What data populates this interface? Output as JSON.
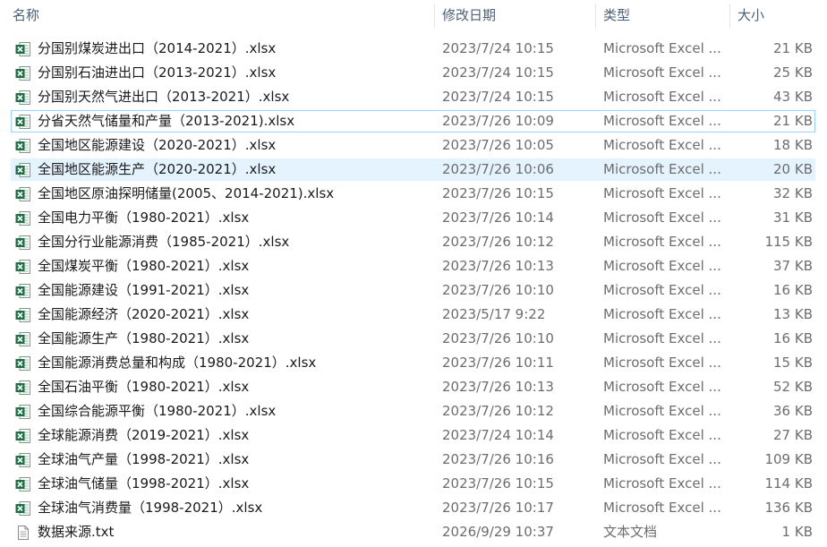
{
  "columns": {
    "name": "名称",
    "date": "修改日期",
    "type": "类型",
    "size": "大小"
  },
  "sort_arrow": "^",
  "files": [
    {
      "name": "分国别煤炭进出口（2014-2021）.xlsx",
      "date": "2023/7/24 10:15",
      "type": "Microsoft Excel ...",
      "size": "21 KB",
      "icon": "excel-file-icon"
    },
    {
      "name": "分国别石油进出口（2013-2021）.xlsx",
      "date": "2023/7/24 10:15",
      "type": "Microsoft Excel ...",
      "size": "25 KB",
      "icon": "excel-file-icon"
    },
    {
      "name": "分国别天然气进出口（2013-2021）.xlsx",
      "date": "2023/7/24 10:15",
      "type": "Microsoft Excel ...",
      "size": "43 KB",
      "icon": "excel-file-icon"
    },
    {
      "name": "分省天然气储量和产量（2013-2021).xlsx",
      "date": "2023/7/26 10:09",
      "type": "Microsoft Excel ...",
      "size": "21 KB",
      "icon": "excel-file-icon"
    },
    {
      "name": "全国地区能源建设（2020-2021）.xlsx",
      "date": "2023/7/26 10:05",
      "type": "Microsoft Excel ...",
      "size": "18 KB",
      "icon": "excel-file-icon"
    },
    {
      "name": "全国地区能源生产（2020-2021）.xlsx",
      "date": "2023/7/26 10:06",
      "type": "Microsoft Excel ...",
      "size": "20 KB",
      "icon": "excel-file-icon"
    },
    {
      "name": "全国地区原油探明储量(2005、2014-2021).xlsx",
      "date": "2023/7/26 10:15",
      "type": "Microsoft Excel ...",
      "size": "32 KB",
      "icon": "excel-file-icon"
    },
    {
      "name": "全国电力平衡（1980-2021）.xlsx",
      "date": "2023/7/26 10:14",
      "type": "Microsoft Excel ...",
      "size": "31 KB",
      "icon": "excel-file-icon"
    },
    {
      "name": "全国分行业能源消费（1985-2021）.xlsx",
      "date": "2023/7/26 10:12",
      "type": "Microsoft Excel ...",
      "size": "115 KB",
      "icon": "excel-file-icon"
    },
    {
      "name": "全国煤炭平衡（1980-2021）.xlsx",
      "date": "2023/7/26 10:13",
      "type": "Microsoft Excel ...",
      "size": "37 KB",
      "icon": "excel-file-icon"
    },
    {
      "name": "全国能源建设（1991-2021）.xlsx",
      "date": "2023/7/26 10:10",
      "type": "Microsoft Excel ...",
      "size": "16 KB",
      "icon": "excel-file-icon"
    },
    {
      "name": "全国能源经济（2020-2021）.xlsx",
      "date": "2023/5/17 9:22",
      "type": "Microsoft Excel ...",
      "size": "13 KB",
      "icon": "excel-file-icon"
    },
    {
      "name": "全国能源生产（1980-2021）.xlsx",
      "date": "2023/7/26 10:10",
      "type": "Microsoft Excel ...",
      "size": "16 KB",
      "icon": "excel-file-icon"
    },
    {
      "name": "全国能源消费总量和构成（1980-2021）.xlsx",
      "date": "2023/7/26 10:11",
      "type": "Microsoft Excel ...",
      "size": "15 KB",
      "icon": "excel-file-icon"
    },
    {
      "name": "全国石油平衡（1980-2021）.xlsx",
      "date": "2023/7/26 10:13",
      "type": "Microsoft Excel ...",
      "size": "52 KB",
      "icon": "excel-file-icon"
    },
    {
      "name": "全国综合能源平衡（1980-2021）.xlsx",
      "date": "2023/7/26 10:12",
      "type": "Microsoft Excel ...",
      "size": "36 KB",
      "icon": "excel-file-icon"
    },
    {
      "name": "全球能源消费（2019-2021）.xlsx",
      "date": "2023/7/24 10:14",
      "type": "Microsoft Excel ...",
      "size": "27 KB",
      "icon": "excel-file-icon"
    },
    {
      "name": "全球油气产量（1998-2021）.xlsx",
      "date": "2023/7/26 10:16",
      "type": "Microsoft Excel ...",
      "size": "109 KB",
      "icon": "excel-file-icon"
    },
    {
      "name": "全球油气储量（1998-2021）.xlsx",
      "date": "2023/7/26 10:15",
      "type": "Microsoft Excel ...",
      "size": "114 KB",
      "icon": "excel-file-icon"
    },
    {
      "name": "全球油气消费量（1998-2021）.xlsx",
      "date": "2023/7/26 10:17",
      "type": "Microsoft Excel ...",
      "size": "136 KB",
      "icon": "excel-file-icon"
    },
    {
      "name": "数据来源.txt",
      "date": "2026/9/29 10:37",
      "type": "文本文档",
      "size": "1 KB",
      "icon": "text-file-icon"
    }
  ],
  "focused_index": 3,
  "selected_index": 5,
  "colors": {
    "header_text": "#4c607a",
    "name_text": "#1a1a1a",
    "meta_text": "#6d6d6d",
    "selection_bg": "#e5f3ff",
    "focus_border": "#99d1ff",
    "excel_green": "#1d7044"
  }
}
